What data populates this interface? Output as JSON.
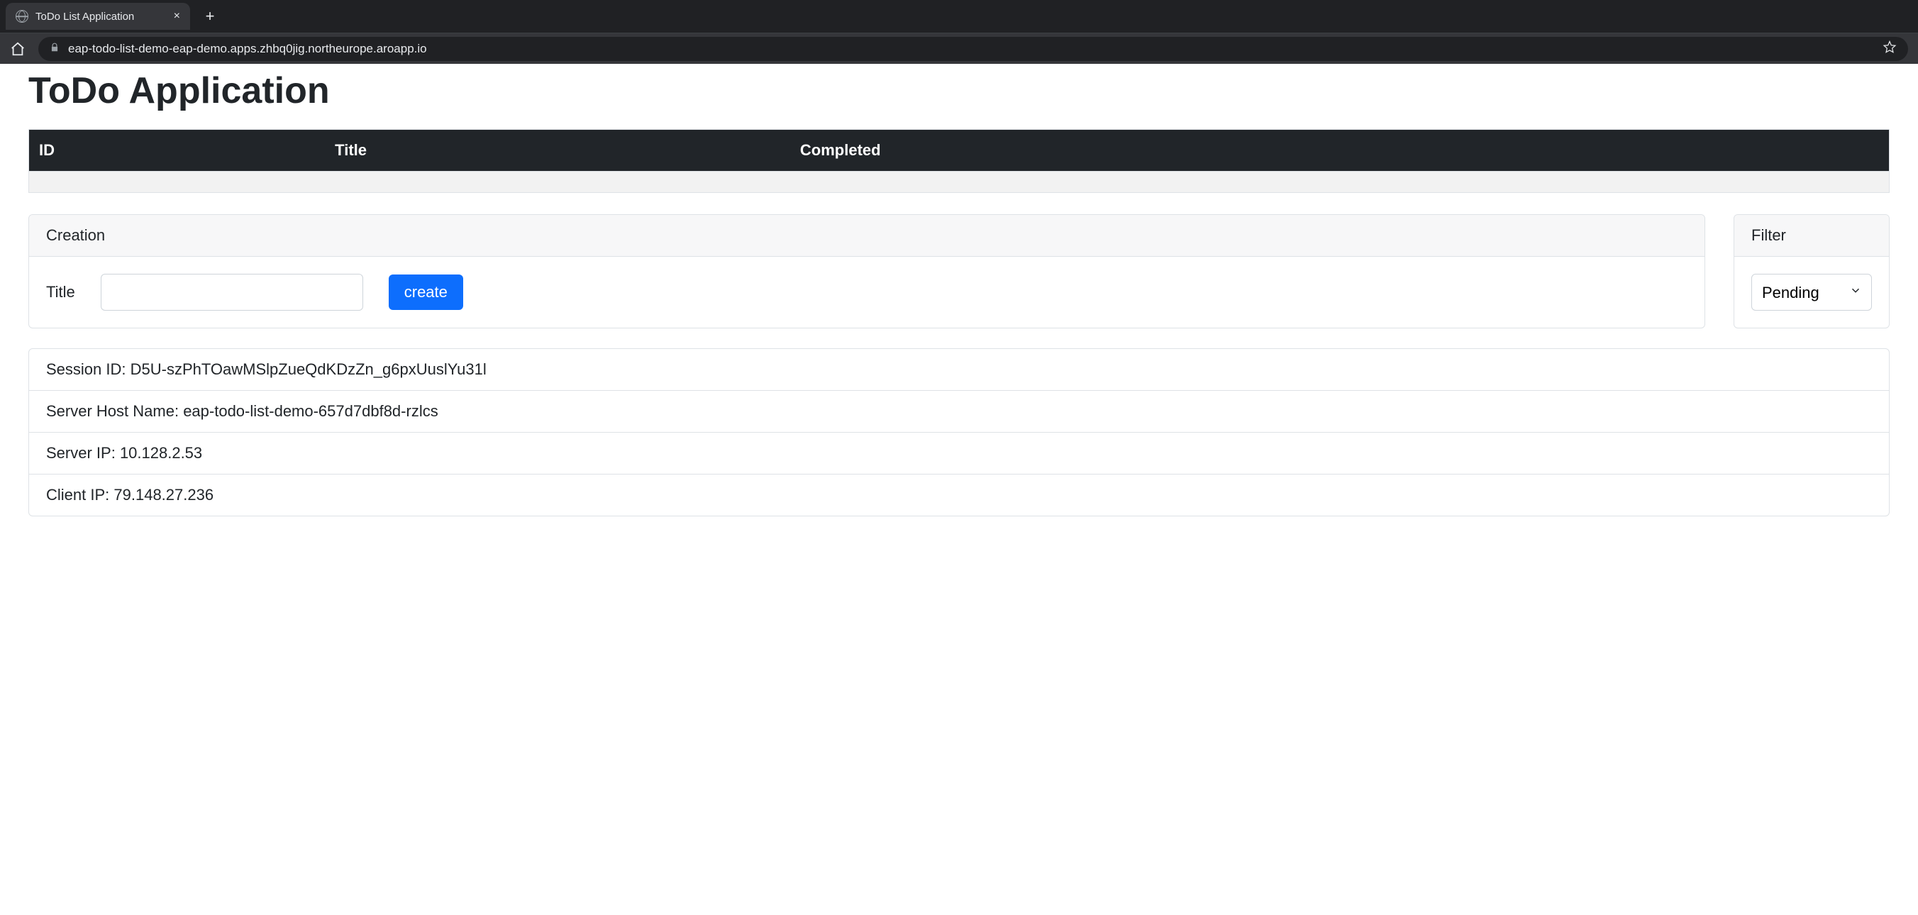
{
  "browser": {
    "tab_title": "ToDo List Application",
    "url": "eap-todo-list-demo-eap-demo.apps.zhbq0jig.northeurope.aroapp.io"
  },
  "page": {
    "title": "ToDo Application"
  },
  "table": {
    "headers": {
      "id": "ID",
      "title": "Title",
      "completed": "Completed"
    }
  },
  "creation": {
    "header": "Creation",
    "title_label": "Title",
    "title_value": "",
    "create_button": "create"
  },
  "filter": {
    "header": "Filter",
    "selected": "Pending"
  },
  "info": {
    "session_label": "Session ID",
    "session_value": "D5U-szPhTOawMSlpZueQdKDzZn_g6pxUuslYu31l",
    "hostname_label": "Server Host Name",
    "hostname_value": "eap-todo-list-demo-657d7dbf8d-rzlcs",
    "server_ip_label": "Server IP",
    "server_ip_value": "10.128.2.53",
    "client_ip_label": "Client IP",
    "client_ip_value": "79.148.27.236"
  }
}
